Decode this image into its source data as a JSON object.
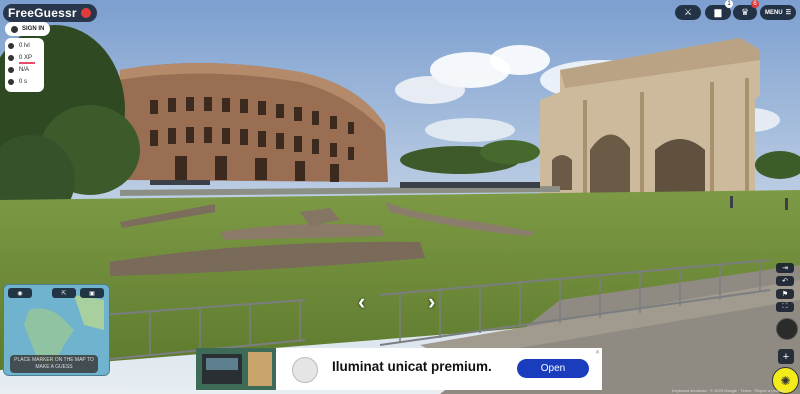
{
  "app": {
    "logo_text": "FreeGuessr"
  },
  "account": {
    "signin_label": "SIGN IN"
  },
  "stats": [
    {
      "label": "0 lvl"
    },
    {
      "label": "0 XP"
    },
    {
      "label": "N/A"
    },
    {
      "label": "0 s"
    }
  ],
  "top_right": {
    "battle_icon": "crossed-swords-icon",
    "multiplayer_badge": "1",
    "daily_badge": "6",
    "menu_label": "MENU"
  },
  "map": {
    "guess_line1": "PLACE MARKER ON THE MAP TO",
    "guess_line2": "MAKE A GUESS"
  },
  "ad": {
    "headline": "Iluminat unicat premium.",
    "cta": "Open",
    "close": "✕"
  },
  "footer": {
    "text": "Keyboard shortcuts  ·  © 2025 Google  ·  Terms  ·  Report a problem"
  },
  "colors": {
    "sky": "#9bb6d8",
    "grass": "#6f8a3a",
    "badge_red": "#e23b3b",
    "cta_blue": "#1a3dbd"
  }
}
